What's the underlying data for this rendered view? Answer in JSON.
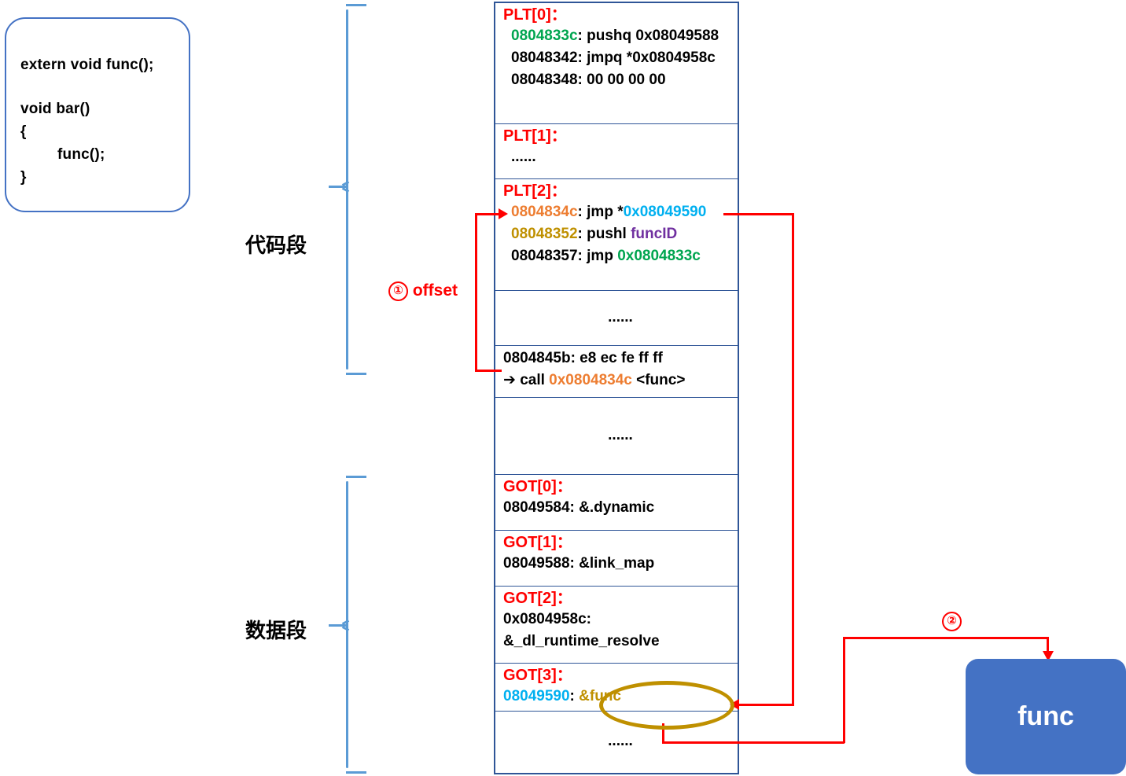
{
  "source_code": {
    "lines": [
      {
        "text": "extern void func();",
        "color": "#ff0000"
      },
      {
        "text": "void bar()",
        "color": "#000000"
      },
      {
        "text": "{",
        "color": "#000000"
      },
      {
        "text": "func();",
        "color": "#ff0000"
      },
      {
        "text": "}",
        "color": "#000000"
      }
    ]
  },
  "segments": {
    "code_label": "代码段",
    "data_label": "数据段"
  },
  "annotations": {
    "offset": {
      "num": "①",
      "text": "offset"
    },
    "resolve": {
      "num": "②",
      "text": ""
    }
  },
  "memory": {
    "rows": [
      {
        "header": "PLT[0]：",
        "lines": [
          {
            "parts": [
              {
                "t": "0804833c",
                "c": "green"
              },
              {
                "t": ": pushq 0x08049588",
                "c": "black"
              }
            ]
          },
          {
            "parts": [
              {
                "t": "08048342: jmpq *0x0804958c",
                "c": "black"
              }
            ]
          },
          {
            "parts": [
              {
                "t": "08048348: 00 00 00 00",
                "c": "black"
              }
            ]
          }
        ]
      },
      {
        "header": "PLT[1]：",
        "lines": [
          {
            "parts": [
              {
                "t": "......",
                "c": "black"
              }
            ]
          }
        ]
      },
      {
        "header": "PLT[2]：",
        "lines": [
          {
            "parts": [
              {
                "t": "0804834c",
                "c": "orange"
              },
              {
                "t": ": jmp *",
                "c": "black"
              },
              {
                "t": "0x08049590",
                "c": "cyan"
              }
            ]
          },
          {
            "parts": [
              {
                "t": "08048352",
                "c": "gold"
              },
              {
                "t": ": pushl ",
                "c": "black"
              },
              {
                "t": "funcID",
                "c": "purple"
              }
            ]
          },
          {
            "parts": [
              {
                "t": "08048357: jmp ",
                "c": "black"
              },
              {
                "t": "0x0804833c",
                "c": "green"
              }
            ]
          }
        ]
      },
      {
        "header": "",
        "dots": "......"
      },
      {
        "header": "",
        "lines": [
          {
            "parts": [
              {
                "t": "0804845b: e8 ec fe ff ff",
                "c": "black"
              }
            ]
          },
          {
            "parts": [
              {
                "t": "➔ call ",
                "c": "black"
              },
              {
                "t": "0x0804834c",
                "c": "orange"
              },
              {
                "t": " <func>",
                "c": "black"
              }
            ]
          }
        ]
      },
      {
        "header": "",
        "dots": "......"
      },
      {
        "header": "GOT[0]：",
        "lines": [
          {
            "parts": [
              {
                "t": "08049584:  &.dynamic",
                "c": "black"
              }
            ]
          }
        ]
      },
      {
        "header": "GOT[1]：",
        "lines": [
          {
            "parts": [
              {
                "t": "08049588:  &link_map",
                "c": "black"
              }
            ]
          }
        ]
      },
      {
        "header": "GOT[2]：",
        "lines": [
          {
            "parts": [
              {
                "t": "0x0804958c:",
                "c": "black"
              }
            ]
          },
          {
            "parts": [
              {
                "t": "&_dl_runtime_resolve",
                "c": "black"
              }
            ]
          }
        ]
      },
      {
        "header": "GOT[3]：",
        "lines": [
          {
            "parts": [
              {
                "t": "08049590",
                "c": "cyan"
              },
              {
                "t": ":   ",
                "c": "black"
              },
              {
                "t": "&func",
                "c": "gold"
              }
            ]
          }
        ]
      },
      {
        "header": "",
        "dots": "......"
      }
    ]
  },
  "func_box": {
    "label": "func",
    "color": "#4472c4"
  }
}
